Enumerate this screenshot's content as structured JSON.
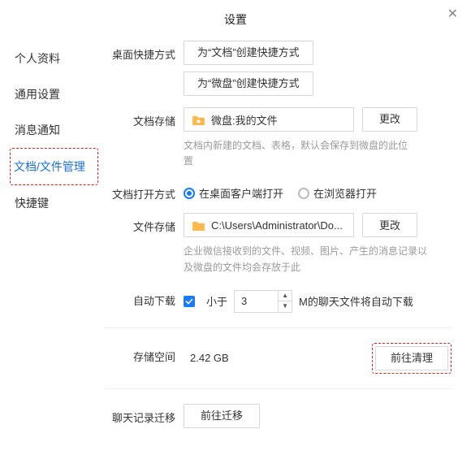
{
  "title": "设置",
  "sidebar": {
    "items": [
      {
        "label": "个人资料"
      },
      {
        "label": "通用设置"
      },
      {
        "label": "消息通知"
      },
      {
        "label": "文档/文件管理"
      },
      {
        "label": "快捷键"
      }
    ]
  },
  "shortcut": {
    "label": "桌面快捷方式",
    "btn_doc": "为“文档”创建快捷方式",
    "btn_drive": "为“微盘”创建快捷方式"
  },
  "doc_storage": {
    "label": "文档存储",
    "path": "微盘:我的文件",
    "change": "更改",
    "hint": "文档内新建的文档、表格，默认会保存到微盘的此位置"
  },
  "open_mode": {
    "label": "文档打开方式",
    "opt_client": "在桌面客户端打开",
    "opt_browser": "在浏览器打开"
  },
  "file_storage": {
    "label": "文件存储",
    "path": "C:\\Users\\Administrator\\Do...",
    "change": "更改",
    "hint": "企业微信接收到的文件、视频、图片、产生的消息记录以及微盘的文件均会存放于此"
  },
  "auto_download": {
    "label": "自动下载",
    "less_than": "小于",
    "value": "3",
    "suffix": "M的聊天文件将自动下载"
  },
  "storage_space": {
    "label": "存储空间",
    "value": "2.42 GB",
    "clean": "前往清理"
  },
  "migrate": {
    "label": "聊天记录迁移",
    "btn": "前往迁移"
  }
}
